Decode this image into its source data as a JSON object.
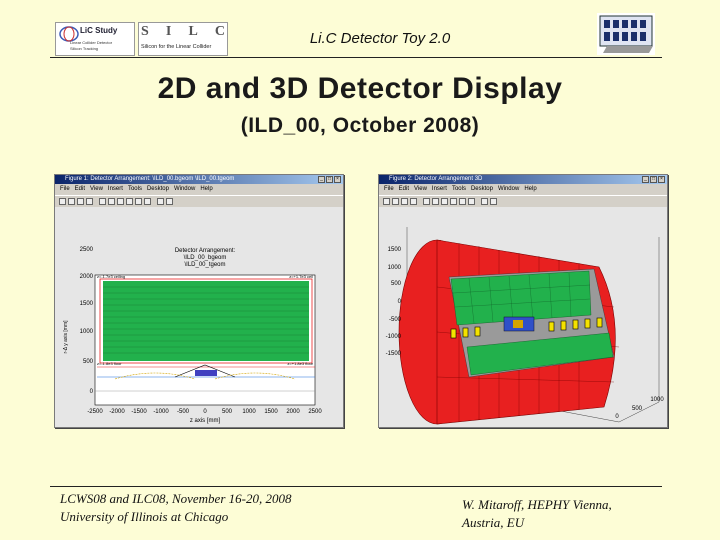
{
  "header": {
    "title": "Li.C Detector Toy 2.0"
  },
  "logos": {
    "lic": {
      "line1": "LiC Study",
      "line2": "Linear Collider Detector",
      "line3": "Silicon Tracking"
    },
    "silc": {
      "letters": [
        "S",
        "I",
        "L",
        "C"
      ],
      "tagline": "Silicon for the Linear Collider"
    }
  },
  "main": {
    "title": "2D and 3D Detector Display",
    "subtitle": "(ILD_00, October 2008)"
  },
  "figure1": {
    "window_title": "Figure 1: Detector Arrangement: \\ILD_00.bgeom \\ILD_00.tgeom",
    "menu": [
      "File",
      "Edit",
      "View",
      "Insert",
      "Tools",
      "Desktop",
      "Window",
      "Help"
    ],
    "plot_title": [
      "Detector Arrangement:",
      "\\ILD_00_bgeom",
      "\\ILD_00_tgeom"
    ],
    "ylabel": "r-Δ y axis [mm]",
    "xlabel": "z axis [mm]",
    "yticks": [
      "2500",
      "2000",
      "1500",
      "1000",
      "500",
      "0"
    ],
    "xticks": [
      "-2500",
      "-2000",
      "-1500",
      "-1000",
      "-500",
      "0",
      "500",
      "1000",
      "1500",
      "2000",
      "2500"
    ],
    "annotations": [
      "z=-1.7e3 ceiling",
      "z=+1.7e3 ceil",
      "z=-1.8e3 floor",
      "z=+1.8e3 floor"
    ]
  },
  "figure2": {
    "window_title": "Figure 2: Detector Arrangement 3D",
    "menu": [
      "File",
      "Edit",
      "View",
      "Insert",
      "Tools",
      "Desktop",
      "Window",
      "Help"
    ],
    "yticks": [
      "1500",
      "1000",
      "500",
      "0",
      "-500",
      "-1000",
      "-1500"
    ],
    "xticks": [
      "0",
      "500",
      "1000"
    ]
  },
  "footer": {
    "left_line1": "LCWS08 and ILC08, November 16-20, 2008",
    "left_line2": "University of Illinois at Chicago",
    "right_line1": "W. Mitaroff, HEPHY Vienna,",
    "right_line2": "Austria, EU"
  },
  "colors": {
    "background": "#fdfdd6",
    "detector_green": "#22b14c",
    "barrel_red": "#e82020"
  }
}
